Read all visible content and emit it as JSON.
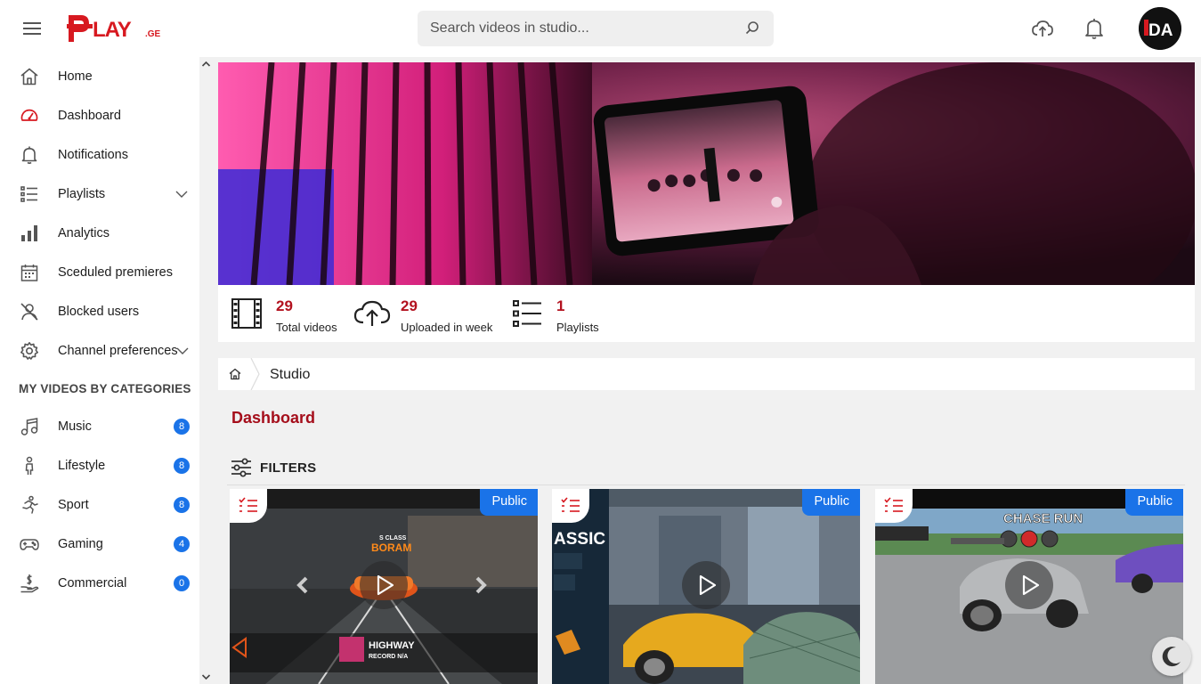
{
  "header": {
    "logo_text": "PLAY.GE",
    "search_placeholder": "Search videos in studio...",
    "avatar_initials": "DA"
  },
  "sidebar": {
    "items": [
      {
        "label": "Home",
        "icon": "home-icon"
      },
      {
        "label": "Dashboard",
        "icon": "dashboard-icon",
        "active": true
      },
      {
        "label": "Notifications",
        "icon": "bell-icon"
      },
      {
        "label": "Playlists",
        "icon": "playlist-icon",
        "expandable": true
      },
      {
        "label": "Analytics",
        "icon": "analytics-icon"
      },
      {
        "label": "Sceduled premieres",
        "icon": "calendar-icon"
      },
      {
        "label": "Blocked users",
        "icon": "blocked-user-icon"
      },
      {
        "label": "Channel preferences",
        "icon": "gear-icon",
        "expandable": true
      }
    ],
    "categories_title": "MY VIDEOS BY CATEGORIES",
    "categories": [
      {
        "label": "Music",
        "count": "8",
        "icon": "music-icon"
      },
      {
        "label": "Lifestyle",
        "count": "8",
        "icon": "lifestyle-icon"
      },
      {
        "label": "Sport",
        "count": "8",
        "icon": "sport-icon"
      },
      {
        "label": "Gaming",
        "count": "4",
        "icon": "gamepad-icon"
      },
      {
        "label": "Commercial",
        "count": "0",
        "icon": "commercial-icon"
      }
    ]
  },
  "stats": [
    {
      "value": "29",
      "caption": "Total videos",
      "icon": "film-icon"
    },
    {
      "value": "29",
      "caption": "Uploaded in week",
      "icon": "cloud-upload-icon"
    },
    {
      "value": "1",
      "caption": "Playlists",
      "icon": "list-icon"
    }
  ],
  "breadcrumb": {
    "current": "Studio"
  },
  "page_title": "Dashboard",
  "filters_label": "FILTERS",
  "videos": [
    {
      "visibility": "Public",
      "thumb_texts": [
        "S CLASS",
        "BORAM",
        "HIGHWAY",
        "RECORD N/A"
      ]
    },
    {
      "visibility": "Public",
      "thumb_texts": [
        "ASSIC"
      ]
    },
    {
      "visibility": "Public",
      "thumb_texts": [
        "CHASE RUN"
      ]
    }
  ],
  "colors": {
    "accent": "#b3121f",
    "badge": "#1a73e8",
    "brand": "#d71920"
  }
}
